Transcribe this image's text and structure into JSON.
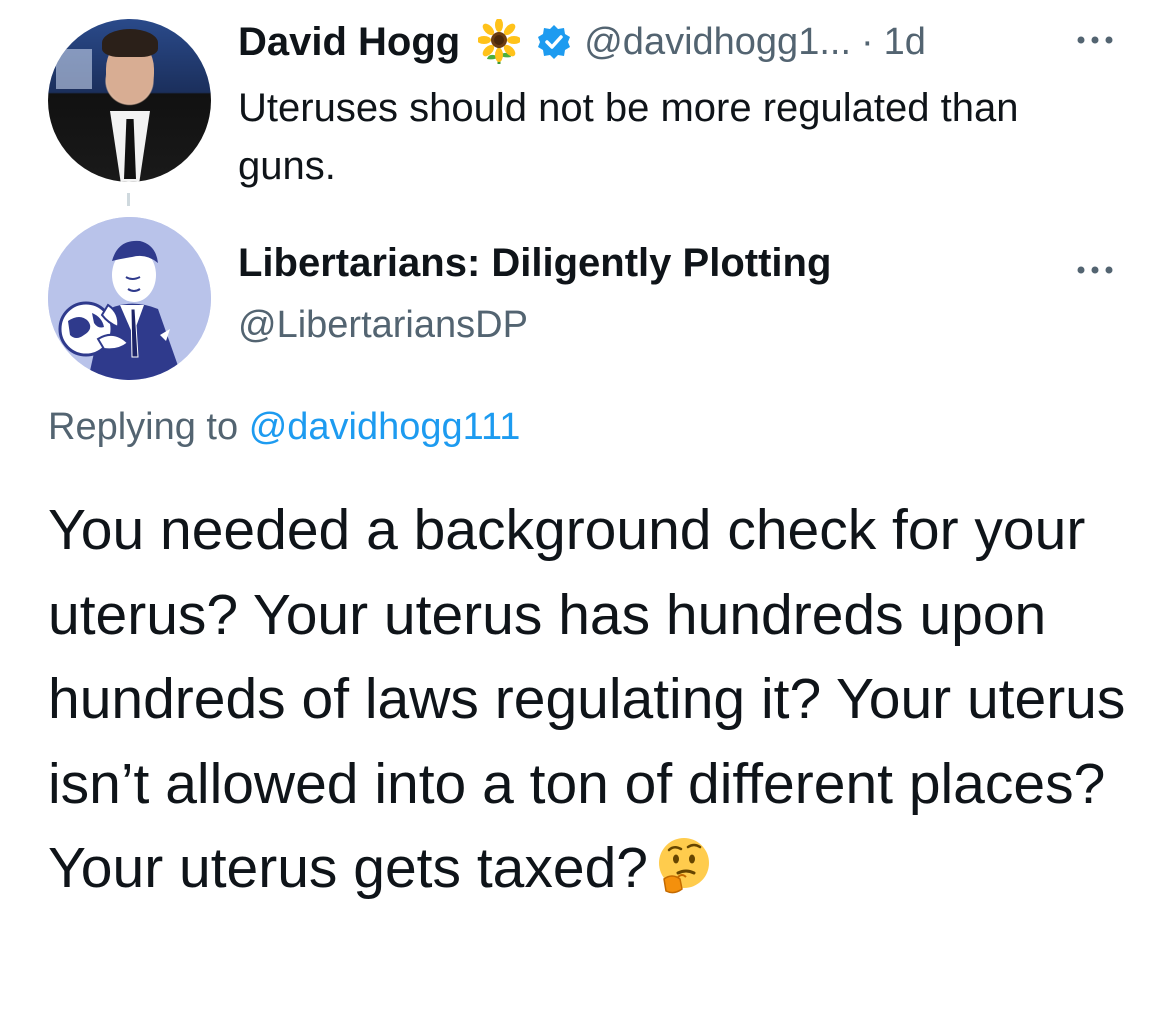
{
  "original_tweet": {
    "author_name": "David Hogg",
    "author_emoji": "sunflower-emoji",
    "verified_icon": "verified-badge-icon",
    "handle": "@davidhogg1...",
    "separator": "·",
    "time": "1d",
    "text": "Uteruses should not be more regulated than guns."
  },
  "reply_tweet": {
    "author_name": "Libertarians: Diligently Plotting",
    "handle": "@LibertariansDP",
    "replying_prefix": "Replying to",
    "replying_mention": "@davidhogg111",
    "text": "You needed a background check for your uterus? Your uterus has hundreds upon hundreds of laws regulating it? Your uterus isn’t allowed into a ton of different places? Your uterus gets taxed?",
    "trailing_emoji": "thinking-face-emoji"
  },
  "colors": {
    "primary_text": "#0f1419",
    "secondary_text": "#536471",
    "link": "#1d9bf0",
    "verified": "#1d9bf0"
  }
}
